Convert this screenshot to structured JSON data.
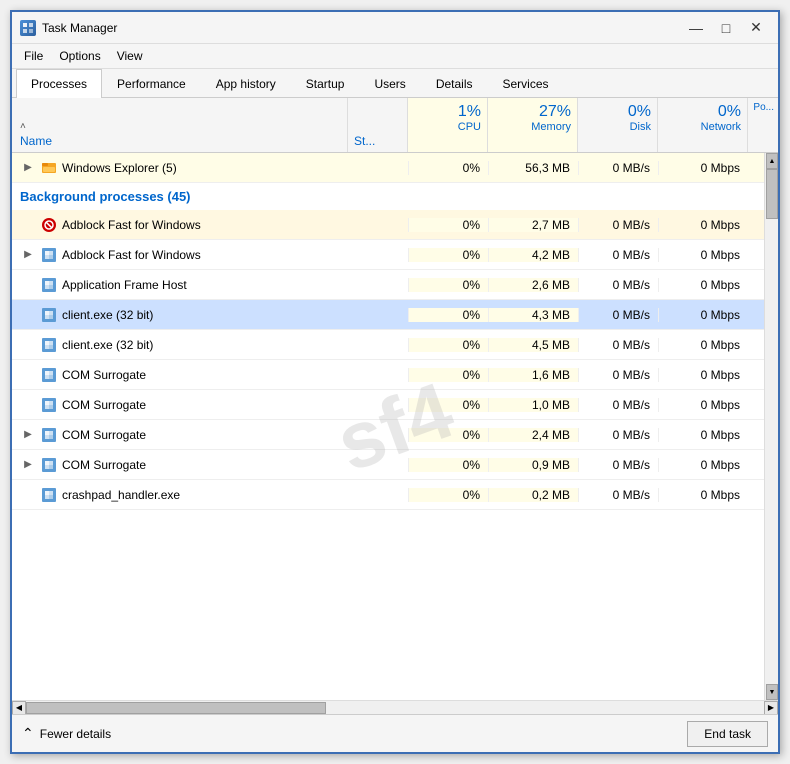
{
  "window": {
    "title": "Task Manager",
    "icon": "TM"
  },
  "title_controls": {
    "minimize": "—",
    "maximize": "□",
    "close": "✕"
  },
  "menu": {
    "items": [
      "File",
      "Options",
      "View"
    ]
  },
  "tabs": [
    {
      "label": "Processes",
      "active": true
    },
    {
      "label": "Performance",
      "active": false
    },
    {
      "label": "App history",
      "active": false
    },
    {
      "label": "Startup",
      "active": false
    },
    {
      "label": "Users",
      "active": false
    },
    {
      "label": "Details",
      "active": false
    },
    {
      "label": "Services",
      "active": false
    }
  ],
  "columns": {
    "name_label": "Name",
    "status_label": "St...",
    "cpu_pct": "1%",
    "cpu_label": "CPU",
    "memory_pct": "27%",
    "memory_label": "Memory",
    "disk_pct": "0%",
    "disk_label": "Disk",
    "network_pct": "0%",
    "network_label": "Network",
    "power_label": "Po..."
  },
  "apps_section": {
    "label": "Windows Explorer (5)",
    "cpu": "0%",
    "memory": "56,3 MB",
    "disk": "0 MB/s",
    "network": "0 Mbps"
  },
  "bg_section": {
    "label": "Background processes (45)"
  },
  "processes": [
    {
      "name": "Adblock Fast for Windows",
      "icon": "adblock",
      "expand": false,
      "cpu": "0%",
      "memory": "2,7 MB",
      "disk": "0 MB/s",
      "network": "0 Mbps",
      "highlighted": true
    },
    {
      "name": "Adblock Fast for Windows",
      "icon": "app",
      "expand": true,
      "cpu": "0%",
      "memory": "4,2 MB",
      "disk": "0 MB/s",
      "network": "0 Mbps",
      "highlighted": false
    },
    {
      "name": "Application Frame Host",
      "icon": "app",
      "expand": false,
      "cpu": "0%",
      "memory": "2,6 MB",
      "disk": "0 MB/s",
      "network": "0 Mbps",
      "highlighted": false
    },
    {
      "name": "client.exe (32 bit)",
      "icon": "app",
      "expand": false,
      "cpu": "0%",
      "memory": "4,3 MB",
      "disk": "0 MB/s",
      "network": "0 Mbps",
      "selected": true,
      "highlighted": false
    },
    {
      "name": "client.exe (32 bit)",
      "icon": "app",
      "expand": false,
      "cpu": "0%",
      "memory": "4,5 MB",
      "disk": "0 MB/s",
      "network": "0 Mbps",
      "highlighted": false
    },
    {
      "name": "COM Surrogate",
      "icon": "app",
      "expand": false,
      "cpu": "0%",
      "memory": "1,6 MB",
      "disk": "0 MB/s",
      "network": "0 Mbps",
      "highlighted": false
    },
    {
      "name": "COM Surrogate",
      "icon": "app",
      "expand": false,
      "cpu": "0%",
      "memory": "1,0 MB",
      "disk": "0 MB/s",
      "network": "0 Mbps",
      "highlighted": false
    },
    {
      "name": "COM Surrogate",
      "icon": "app",
      "expand": true,
      "cpu": "0%",
      "memory": "2,4 MB",
      "disk": "0 MB/s",
      "network": "0 Mbps",
      "highlighted": false
    },
    {
      "name": "COM Surrogate",
      "icon": "app",
      "expand": true,
      "cpu": "0%",
      "memory": "0,9 MB",
      "disk": "0 MB/s",
      "network": "0 Mbps",
      "highlighted": false
    },
    {
      "name": "crashpad_handler.exe",
      "icon": "app",
      "expand": false,
      "cpu": "0%",
      "memory": "0,2 MB",
      "disk": "0 MB/s",
      "network": "0 Mbps",
      "highlighted": false
    }
  ],
  "footer": {
    "fewer_details": "Fewer details",
    "end_task": "End task"
  }
}
